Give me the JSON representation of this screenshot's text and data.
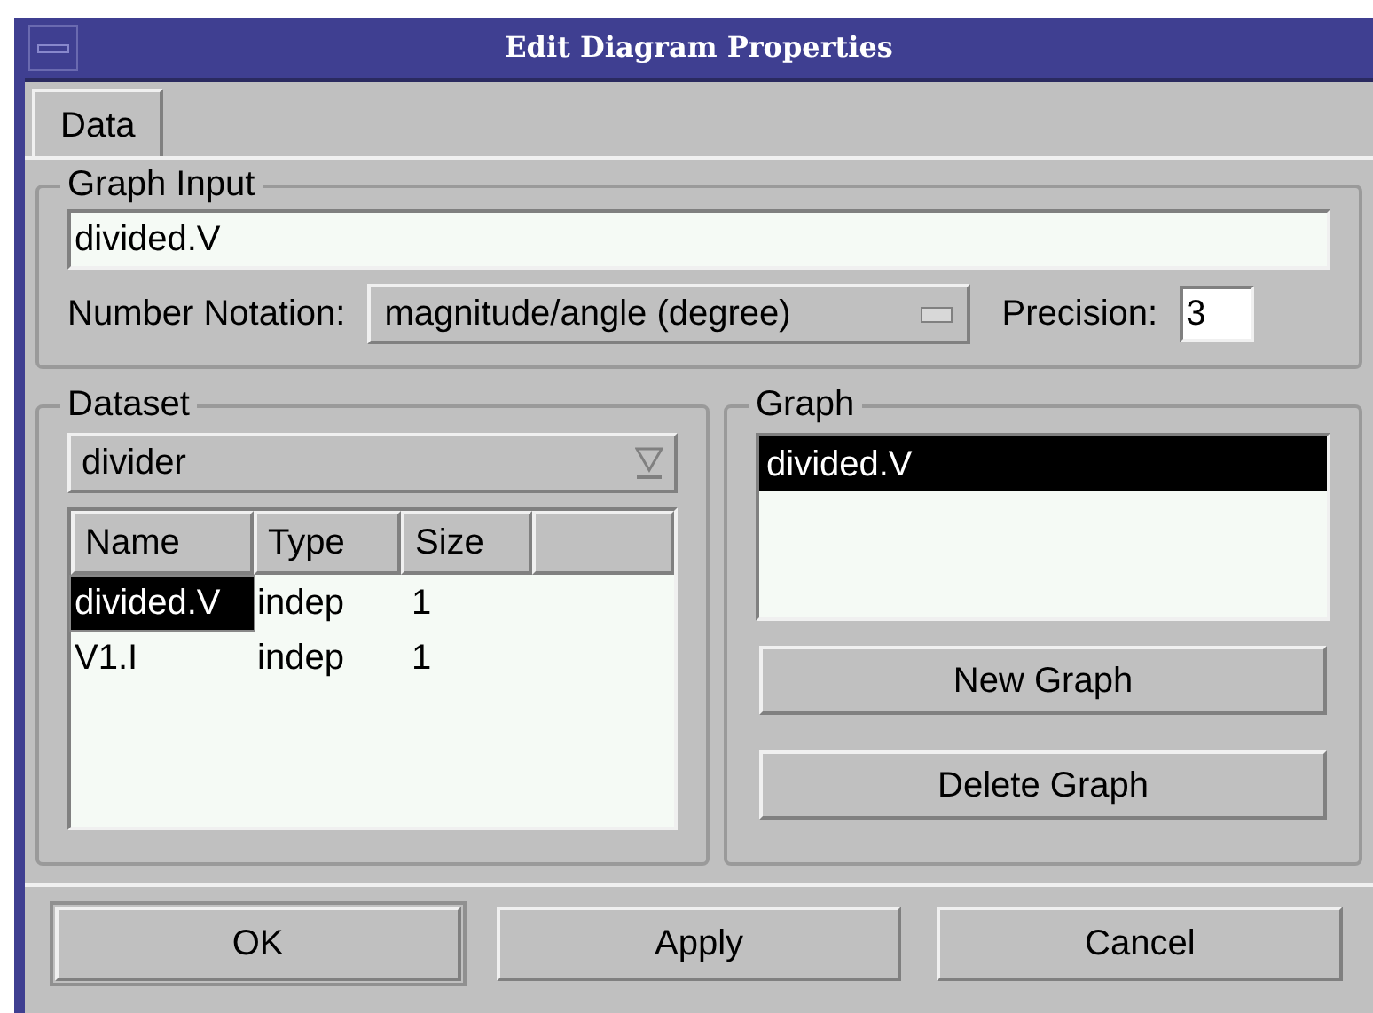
{
  "window": {
    "title": "Edit Diagram Properties"
  },
  "tabs": [
    {
      "label": "Data",
      "selected": true
    }
  ],
  "graph_input": {
    "title": "Graph Input",
    "value": "divided.V",
    "notation_label": "Number Notation:",
    "notation": "magnitude/angle (degree)",
    "precision_label": "Precision:",
    "precision": "3"
  },
  "dataset": {
    "title": "Dataset",
    "selector": "divider",
    "columns": [
      "Name",
      "Type",
      "Size"
    ],
    "rows": [
      {
        "cells": [
          "divided.V",
          "indep",
          "1"
        ],
        "selected": true
      },
      {
        "cells": [
          "V1.I",
          "indep",
          "1"
        ],
        "selected": false
      }
    ]
  },
  "graph": {
    "title": "Graph",
    "items": [
      {
        "label": "divided.V",
        "selected": true
      }
    ],
    "buttons": [
      "New Graph",
      "Delete Graph"
    ]
  },
  "buttons": [
    {
      "label": "OK",
      "default": true
    },
    {
      "label": "Apply",
      "default": false
    },
    {
      "label": "Cancel",
      "default": false
    }
  ]
}
